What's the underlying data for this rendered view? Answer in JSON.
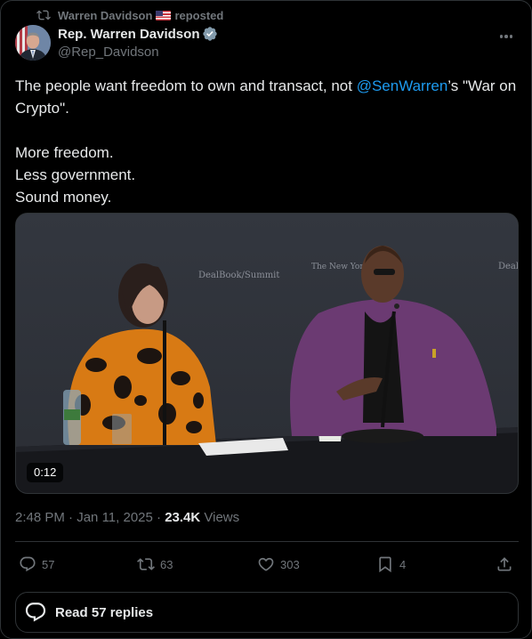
{
  "repost": {
    "name": "Warren Davidson",
    "label": "reposted",
    "icon": "repost-icon"
  },
  "author": {
    "display_name": "Rep. Warren Davidson",
    "handle": "@Rep_Davidson",
    "verified_icon": "verified-badge-icon"
  },
  "tweet": {
    "line1_pre": "The people want freedom to own and transact, not ",
    "mention": "@SenWarren",
    "line1_post": "’s \"War on Crypto\".",
    "line2": "More freedom.",
    "line3": "Less government.",
    "line4": "Sound money."
  },
  "media": {
    "duration": "0:12",
    "backdrop_text_1": "DealBook/Summit",
    "backdrop_text_2": "The New York Times",
    "backdrop_text_3": "Deal"
  },
  "meta": {
    "time": "2:48 PM",
    "sep1": " · ",
    "date": "Jan 11, 2025",
    "sep2": " · ",
    "views_count": "23.4K",
    "views_label": " Views"
  },
  "actions": {
    "replies": "57",
    "reposts": "63",
    "likes": "303",
    "bookmarks": "4"
  },
  "read_replies": {
    "label": "Read 57 replies"
  },
  "colors": {
    "background": "#000000",
    "text": "#e7e9ea",
    "secondary": "#71767b",
    "link": "#1d9bf0",
    "border": "#2f3336"
  }
}
